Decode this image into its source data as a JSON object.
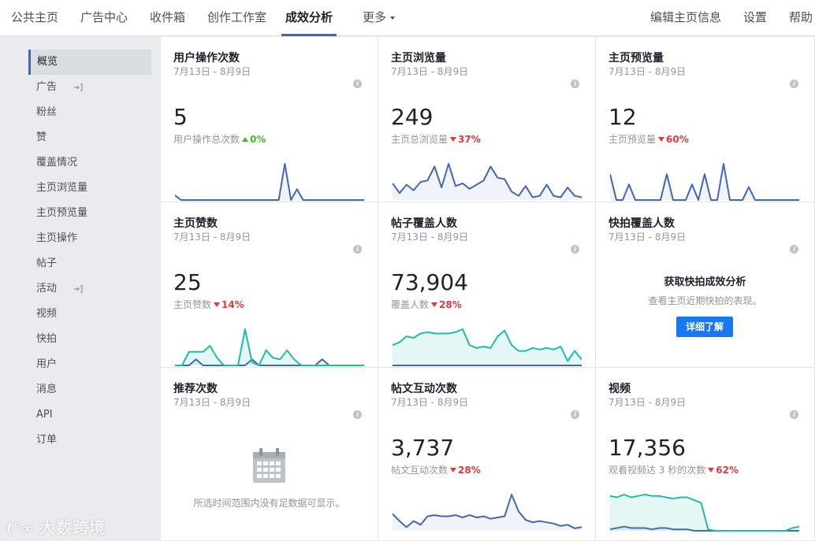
{
  "nav": {
    "items": [
      "公共主页",
      "广告中心",
      "收件箱",
      "创作工作室",
      "成效分析",
      "更多"
    ],
    "active": "成效分析",
    "right_items": [
      "编辑主页信息",
      "设置",
      "帮助"
    ]
  },
  "sidebar": {
    "items": [
      {
        "label": "概览",
        "active": true
      },
      {
        "label": "广告",
        "external": true
      },
      {
        "label": "粉丝"
      },
      {
        "label": "赞"
      },
      {
        "label": "覆盖情况"
      },
      {
        "label": "主页浏览量"
      },
      {
        "label": "主页预览量"
      },
      {
        "label": "主页操作"
      },
      {
        "label": "帖子"
      },
      {
        "label": "活动",
        "external": true
      },
      {
        "label": "视频"
      },
      {
        "label": "快拍"
      },
      {
        "label": "用户"
      },
      {
        "label": "消息"
      },
      {
        "label": "API"
      },
      {
        "label": "订单"
      }
    ]
  },
  "cards": [
    {
      "title": "用户操作次数",
      "date": "7月13日 - 8月9日",
      "value": "5",
      "sub": "用户操作总次数",
      "delta": "0%",
      "dir": "up"
    },
    {
      "title": "主页浏览量",
      "date": "7月13日 - 8月9日",
      "value": "249",
      "sub": "主页总浏览量",
      "delta": "37%",
      "dir": "down"
    },
    {
      "title": "主页预览量",
      "date": "7月13日 - 8月9日",
      "value": "12",
      "sub": "主页预览量",
      "delta": "60%",
      "dir": "down"
    },
    {
      "title": "主页赞数",
      "date": "7月13日 - 8月9日",
      "value": "25",
      "sub": "主页赞数",
      "delta": "14%",
      "dir": "down"
    },
    {
      "title": "帖子覆盖人数",
      "date": "7月13日 - 8月9日",
      "value": "73,904",
      "sub": "覆盖人数",
      "delta": "28%",
      "dir": "down"
    },
    {
      "title": "快拍覆盖人数",
      "date": "7月13日 - 8月9日",
      "promo_title": "获取快拍成效分析",
      "promo_desc": "查看主页近期快拍的表现。",
      "promo_button": "详细了解"
    },
    {
      "title": "推荐次数",
      "date": "7月13日 - 8月9日",
      "empty_text": "所选时间范围内没有足数据可显示。"
    },
    {
      "title": "帖文互动次数",
      "date": "7月13日 - 8月9日",
      "value": "3,737",
      "sub": "帖文互动次数",
      "delta": "28%",
      "dir": "down"
    },
    {
      "title": "视频",
      "date": "7月13日 - 8月9日",
      "value": "17,356",
      "sub": "观看视频达 3 秒的次数",
      "delta": "62%",
      "dir": "down"
    }
  ],
  "sparklines": {
    "actions": [
      [
        4,
        0,
        0,
        0,
        0,
        0,
        0,
        0,
        0,
        0,
        0,
        0,
        0,
        0,
        0,
        0,
        0,
        0,
        30,
        0,
        9,
        0,
        0,
        0,
        0,
        0,
        0,
        0,
        0,
        0,
        0,
        0
      ]
    ],
    "views": [
      [
        12,
        5,
        11,
        7,
        13,
        14,
        24,
        9,
        26,
        10,
        12,
        8,
        11,
        14,
        24,
        16,
        15,
        6,
        3,
        10,
        2,
        3,
        11,
        3,
        2,
        9,
        3,
        2
      ]
    ],
    "previews": [
      [
        20,
        0,
        0,
        12,
        0,
        0,
        0,
        0,
        0,
        20,
        0,
        0,
        0,
        12,
        0,
        20,
        0,
        0,
        28,
        0,
        0,
        0,
        10,
        0,
        0,
        0,
        0,
        0,
        0,
        0,
        0
      ]
    ],
    "likes": [
      [
        0,
        0,
        0,
        8,
        0,
        0,
        0,
        0,
        0,
        0,
        0,
        8,
        0,
        0,
        0,
        0,
        0,
        0,
        0,
        0,
        0,
        8,
        0,
        0,
        0,
        0,
        0,
        0
      ],
      [
        0,
        0,
        18,
        18,
        18,
        26,
        10,
        0,
        0,
        0,
        48,
        4,
        0,
        20,
        10,
        8,
        20,
        8,
        0,
        0,
        0,
        0,
        0,
        0,
        0,
        0,
        0,
        0
      ]
    ],
    "reach": [
      [
        0,
        0,
        0,
        0,
        0,
        0,
        0,
        0,
        0,
        0,
        0,
        0,
        0,
        0,
        0,
        0,
        0,
        0,
        0,
        0,
        0,
        0,
        0,
        0,
        0,
        0,
        0,
        0
      ],
      [
        14,
        16,
        20,
        19,
        22,
        23,
        22,
        22,
        22,
        23,
        25,
        14,
        12,
        13,
        12,
        20,
        24,
        14,
        10,
        10,
        12,
        11,
        12,
        11,
        13,
        3,
        10,
        4
      ]
    ],
    "engagement": [
      [
        14,
        8,
        3,
        8,
        5,
        12,
        13,
        12,
        12,
        13,
        11,
        13,
        11,
        12,
        10,
        11,
        12,
        30,
        16,
        9,
        7,
        8,
        7,
        6,
        4,
        5,
        2,
        3
      ]
    ],
    "video": [
      [
        1,
        2,
        3,
        2,
        2,
        2,
        1,
        2,
        2,
        1,
        1,
        1,
        0,
        0,
        0,
        0,
        0,
        0,
        0,
        0,
        0,
        0,
        0,
        0,
        0,
        0,
        0,
        0
      ],
      [
        25,
        24,
        26,
        24,
        25,
        26,
        25,
        25,
        24,
        23,
        24,
        24,
        22,
        20,
        1,
        0,
        0,
        0,
        0,
        0,
        0,
        0,
        0,
        0,
        0,
        0,
        2,
        3
      ]
    ]
  },
  "colors": {
    "blue": "#4267b2",
    "teal": "#1fbda7",
    "accent": "#4267b2"
  },
  "watermark": "大数跨境"
}
